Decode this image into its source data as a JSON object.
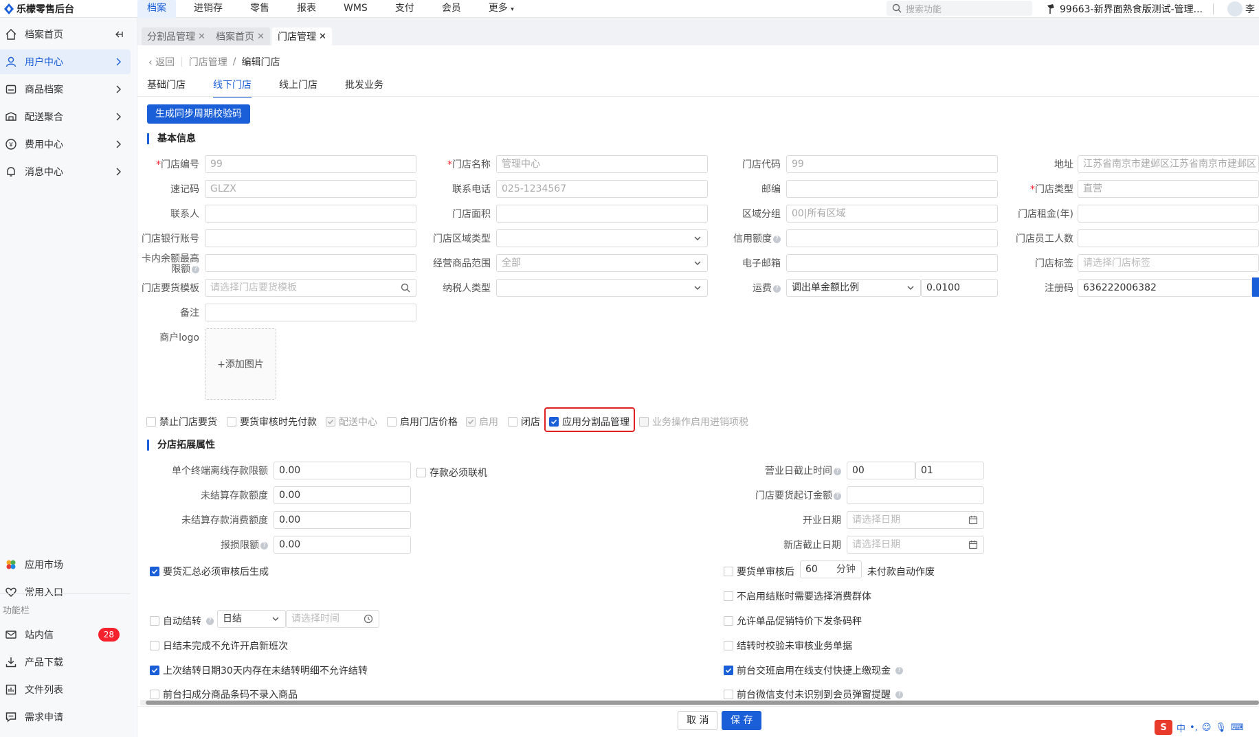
{
  "app": {
    "title": "乐檬零售后台"
  },
  "topnav": [
    "档案",
    "进销存",
    "零售",
    "报表",
    "WMS",
    "支付",
    "会员",
    "更多"
  ],
  "search": {
    "placeholder": "搜索功能"
  },
  "user": {
    "store": "99663-新界面熟食版测试-管理...",
    "name": "李"
  },
  "sidebar": {
    "items": [
      "档案首页",
      "用户中心",
      "商品档案",
      "配送聚合",
      "费用中心",
      "消息中心"
    ],
    "bottom": [
      "应用市场",
      "常用入口"
    ],
    "section": "功能栏",
    "func": [
      "站内信",
      "产品下载",
      "文件列表",
      "需求申请"
    ],
    "badge": "28"
  },
  "pagetabs": [
    "分割品管理",
    "档案首页",
    "门店管理"
  ],
  "breadcrumb": {
    "back": "返回",
    "parent": "门店管理",
    "sep": "/",
    "current": "编辑门店"
  },
  "sectabs": [
    "基础门店",
    "线下门店",
    "线上门店",
    "批发业务"
  ],
  "gen_button": "生成同步周期校验码",
  "basic": {
    "title": "基本信息",
    "store_no": {
      "label": "门店编号",
      "value": "99"
    },
    "store_name": {
      "label": "门店名称",
      "value": "管理中心"
    },
    "store_code": {
      "label": "门店代码",
      "value": "99"
    },
    "address": {
      "label": "地址",
      "value": "江苏省南京市建邺区江苏省南京市建邺区"
    },
    "quick_code": {
      "label": "速记码",
      "value": "GLZX"
    },
    "phone": {
      "label": "联系电话",
      "value": "025-1234567"
    },
    "postcode": {
      "label": "邮编",
      "value": ""
    },
    "store_type": {
      "label": "门店类型",
      "value": "直营"
    },
    "contact": {
      "label": "联系人",
      "value": ""
    },
    "area": {
      "label": "门店面积",
      "value": ""
    },
    "region": {
      "label": "区域分组",
      "value": "00|所有区域"
    },
    "rent": {
      "label": "门店租金(年)",
      "value": ""
    },
    "bank": {
      "label": "门店银行账号",
      "value": ""
    },
    "region_type": {
      "label": "门店区域类型",
      "value": ""
    },
    "credit": {
      "label": "信用额度",
      "value": ""
    },
    "staff": {
      "label": "门店员工人数",
      "value": ""
    },
    "card_limit": {
      "label": "卡内余额最高限额",
      "value": ""
    },
    "scope": {
      "label": "经营商品范围",
      "value": "全部"
    },
    "email": {
      "label": "电子邮箱",
      "value": ""
    },
    "tags": {
      "label": "门店标签",
      "placeholder": "请选择门店标签"
    },
    "template": {
      "label": "门店要货模板",
      "placeholder": "请选择门店要货模板"
    },
    "taxpayer": {
      "label": "纳税人类型",
      "value": ""
    },
    "freight": {
      "label": "运费",
      "mode": "调出单金额比例",
      "value": "0.0100"
    },
    "reg_code": {
      "label": "注册码",
      "value": "636222006382"
    },
    "remark": {
      "label": "备注",
      "value": ""
    },
    "logo": {
      "label": "商户logo",
      "add": "+添加图片"
    }
  },
  "checks": [
    {
      "label": "禁止门店要货",
      "checked": false,
      "disabled": false
    },
    {
      "label": "要货审核时先付款",
      "checked": false,
      "disabled": false
    },
    {
      "label": "配送中心",
      "checked": true,
      "disabled": true
    },
    {
      "label": "启用门店价格",
      "checked": false,
      "disabled": false
    },
    {
      "label": "启用",
      "checked": true,
      "disabled": true
    },
    {
      "label": "闭店",
      "checked": false,
      "disabled": false
    },
    {
      "label": "应用分割品管理",
      "checked": true,
      "disabled": false
    },
    {
      "label": "业务操作启用进销项税",
      "checked": false,
      "disabled": true
    }
  ],
  "ext": {
    "title": "分店拓展属性",
    "offline_limit": {
      "label": "单个终端离线存款限额",
      "value": "0.00"
    },
    "must_online": "存款必须联机",
    "unsettled": {
      "label": "未结算存款额度",
      "value": "0.00"
    },
    "unsettled_consume": {
      "label": "未结算存款消费额度",
      "value": "0.00"
    },
    "loss_limit": {
      "label": "报损限额",
      "value": "0.00"
    },
    "biz_cutoff": {
      "label": "营业日截止时间",
      "h": "00",
      "m": "01"
    },
    "min_order": {
      "label": "门店要货起订金额",
      "value": ""
    },
    "open_date": {
      "label": "开业日期",
      "placeholder": "请选择日期"
    },
    "new_cutoff": {
      "label": "新店截止日期",
      "placeholder": "请选择日期"
    },
    "summary_check": "要货汇总必须审核后生成",
    "auto_close": "自动结转",
    "auto_close_mode": "日结",
    "auto_close_time": "请选择时间",
    "no_new_shift": "日结未完成不允许开启新班次",
    "last_close": "上次结转日期30天内存在未结转明细不允许结转",
    "scan_barcode": "前台扫成分商品条码不录入商品",
    "order_after": "要货单审核后",
    "order_minutes": "60",
    "order_unit": "分钟",
    "order_tail": "未付款自动作废",
    "consume_group": "不启用结账时需要选择消费群体",
    "promo_scale": "允许单品促销特价下发条码秤",
    "check_unaudited": "结转时校验未审核业务单据",
    "shift_cash": "前台交班启用在线支付快捷上缴现金",
    "wechat_pop": "前台微信支付未识别到会员弹窗提醒"
  },
  "footer": {
    "cancel": "取 消",
    "save": "保 存"
  },
  "ime": {
    "logo": "S",
    "lang": "中"
  }
}
